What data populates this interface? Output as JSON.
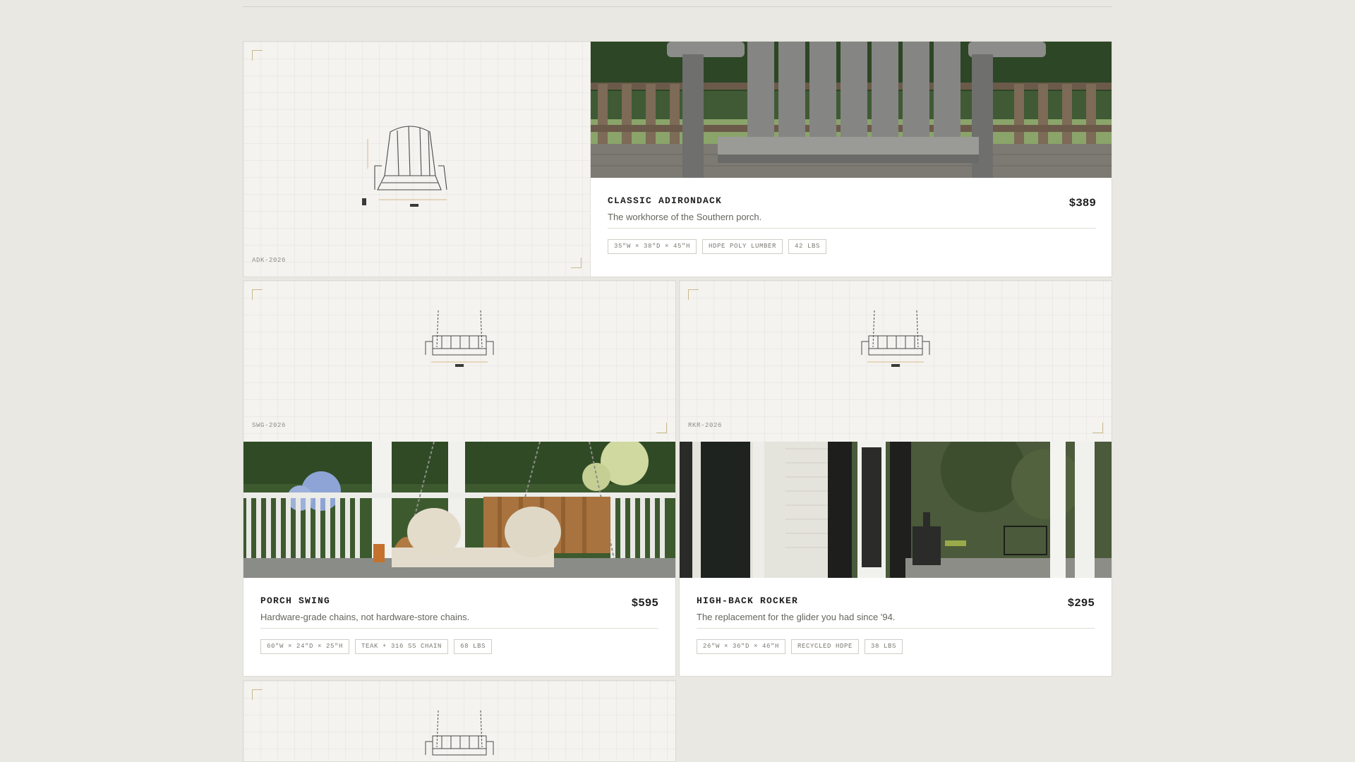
{
  "products": [
    {
      "sku": "ADK-2026",
      "name": "CLASSIC ADIRONDACK",
      "price": "$389",
      "tagline": "The workhorse of the Southern porch.",
      "specs": [
        "35\"W × 38\"D × 45\"H",
        "HDPE POLY LUMBER",
        "42 LBS"
      ]
    },
    {
      "sku": "SWG-2026",
      "name": "PORCH SWING",
      "price": "$595",
      "tagline": "Hardware-grade chains, not hardware-store chains.",
      "specs": [
        "60\"W × 24\"D × 25\"H",
        "TEAK + 316 SS CHAIN",
        "68 LBS"
      ]
    },
    {
      "sku": "RKR-2026",
      "name": "HIGH-BACK ROCKER",
      "price": "$295",
      "tagline": "The replacement for the glider you had since '94.",
      "specs": [
        "26\"W × 36\"D × 46\"H",
        "RECYCLED HDPE",
        "38 LBS"
      ]
    }
  ],
  "colors": {
    "page_background": "#e9e8e3",
    "card_background": "#ffffff",
    "blueprint_background": "#f4f3ef",
    "accent_line": "#c9b98a",
    "text_primary": "#1e1e1e",
    "text_secondary": "#66645e"
  }
}
